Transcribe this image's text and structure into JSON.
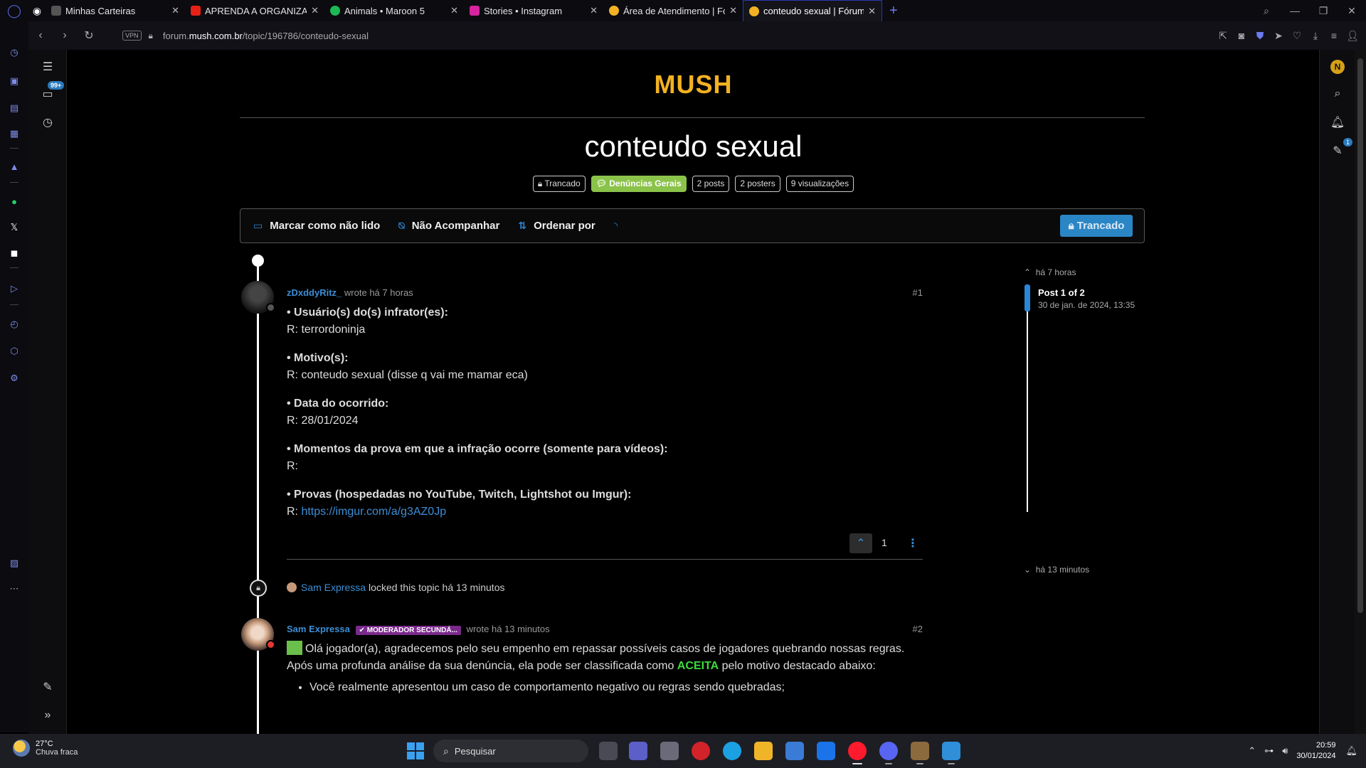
{
  "browser": {
    "tabs": [
      {
        "title": "Minhas Carteiras",
        "color": "#888888"
      },
      {
        "title": "APRENDA A ORGANIZAR S",
        "color": "#e62117"
      },
      {
        "title": "Animals • Maroon 5",
        "color": "#1db954"
      },
      {
        "title": "Stories • Instagram",
        "color": "#d6249f"
      },
      {
        "title": "Área de Atendimento | Fór",
        "color": "#f3b221"
      },
      {
        "title": "conteudo sexual | Fórum M",
        "color": "#f3b221"
      }
    ],
    "url_prefix": "forum.",
    "url_domain": "mush.com.br",
    "url_path": "/topic/196786/conteudo-sexual",
    "vpn_label": "VPN"
  },
  "forum": {
    "logo": "MUSH",
    "sidebar_badge": "99+",
    "notif_badge": "1",
    "user_initial": "N"
  },
  "topic": {
    "title": "conteudo sexual",
    "tags": {
      "locked": "Trancado",
      "category": "Denúncias Gerais",
      "posts": "2 posts",
      "posters": "2 posters",
      "views": "9 visualizações"
    },
    "toolbar": {
      "mark_unread": "Marcar como não lido",
      "unfollow": "Não Acompanhar",
      "sort": "Ordenar por",
      "locked_button": "Trancado"
    }
  },
  "post1": {
    "user": "zDxddyRitz_",
    "wrote": "wrote há 7 horas",
    "number": "#1",
    "q1": "• Usuário(s) do(s) infrator(es):",
    "a1": "R: terrordoninja",
    "q2": "• Motivo(s):",
    "a2": "R: conteudo sexual (disse q vai me mamar eca)",
    "q3": "• Data do ocorrido:",
    "a3": "R: 28/01/2024",
    "q4": "• Momentos da prova em que a infração ocorre (somente para vídeos):",
    "a4": "R:",
    "q5": "• Provas (hospedadas no YouTube, Twitch, Lightshot ou Imgur):",
    "a5_prefix": "R: ",
    "a5_link": "https://imgur.com/a/g3AZ0Jp",
    "votes": "1"
  },
  "lock_event": {
    "user": "Sam Expressa",
    "text": "locked this topic há 13 minutos"
  },
  "post2": {
    "user": "Sam Expressa",
    "badge": "MODERADOR SECUNDÁ...",
    "wrote": "wrote há 13 minutos",
    "number": "#2",
    "line1": "Olá jogador(a), agradecemos pelo seu empenho em repassar possíveis casos de jogadores quebrando nossas regras.",
    "line2_a": "Após uma profunda análise da sua denúncia, ela pode ser classificada como ",
    "line2_b": "ACEITA",
    "line2_c": " pelo motivo destacado abaixo:",
    "bullet1": "Você realmente apresentou um caso de comportamento negativo ou regras sendo quebradas;"
  },
  "scroller": {
    "top": "há 7 horas",
    "post": "Post 1 of 2",
    "date": "30 de jan. de 2024, 13:35",
    "bottom": "há 13 minutos"
  },
  "taskbar": {
    "temp": "27°C",
    "weather": "Chuva fraca",
    "search": "Pesquisar",
    "time": "20:59",
    "date": "30/01/2024"
  }
}
